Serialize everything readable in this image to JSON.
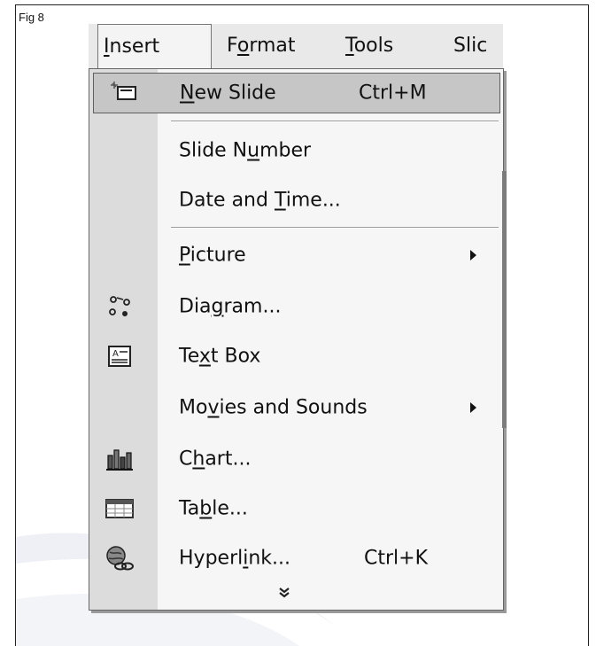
{
  "figure": {
    "label": "Fig 8"
  },
  "menubar": {
    "items": [
      {
        "label": "Insert",
        "active": true
      },
      {
        "label": "Format"
      },
      {
        "label": "Tools"
      },
      {
        "label": "Slic"
      }
    ]
  },
  "insert_menu": {
    "items": [
      {
        "label": "New Slide",
        "shortcut": "Ctrl+M",
        "icon": "new-slide-icon",
        "highlighted": true
      },
      {
        "label": "Slide Number"
      },
      {
        "label": "Date and Time..."
      },
      {
        "label": "Picture",
        "submenu": true
      },
      {
        "label": "Diagram...",
        "icon": "diagram-icon"
      },
      {
        "label": "Text Box",
        "icon": "text-box-icon"
      },
      {
        "label": "Movies and Sounds",
        "submenu": true
      },
      {
        "label": "Chart...",
        "icon": "chart-icon"
      },
      {
        "label": "Table...",
        "icon": "table-icon"
      },
      {
        "label": "Hyperlink...",
        "shortcut": "Ctrl+K",
        "icon": "hyperlink-icon"
      }
    ],
    "expand_glyph": "»"
  }
}
